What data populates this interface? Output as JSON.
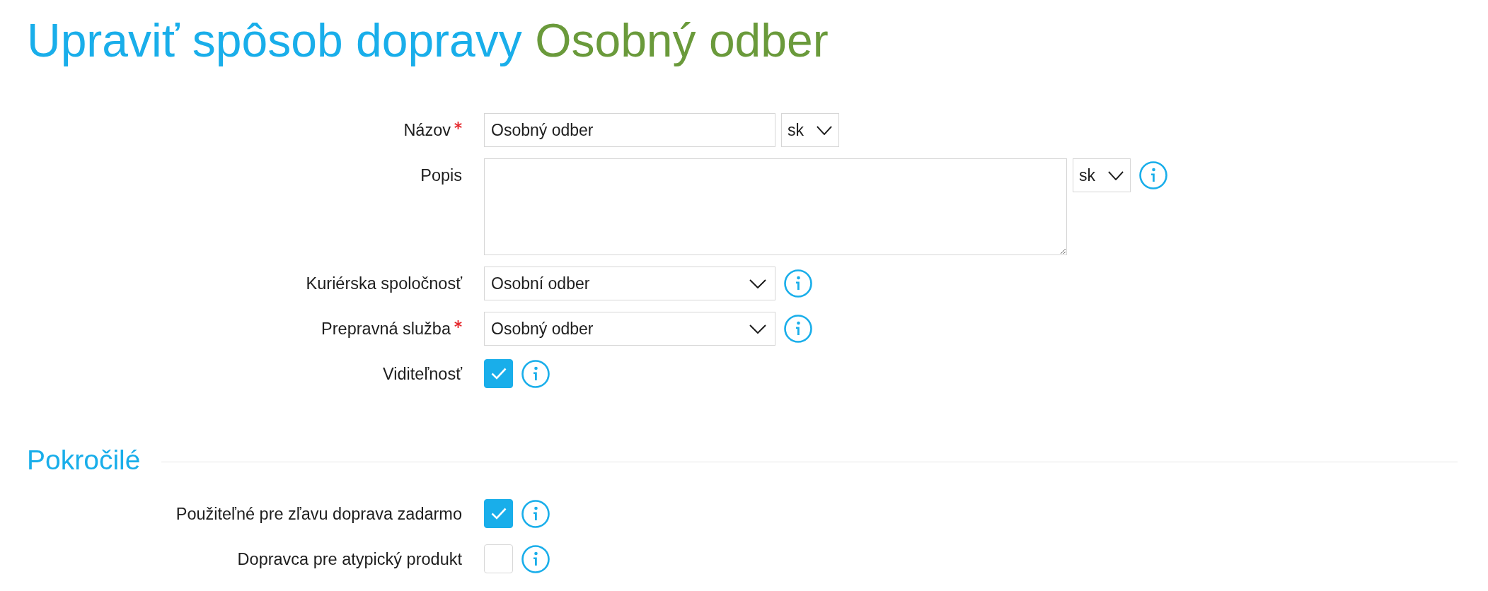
{
  "title": {
    "action": "Upraviť spôsob dopravy",
    "subject": "Osobný odber"
  },
  "form": {
    "fields": [
      {
        "kind": "text",
        "label": "Názov",
        "required": true,
        "value": "Osobný odber",
        "language": "sk",
        "info": false
      },
      {
        "kind": "textarea",
        "label": "Popis",
        "required": false,
        "language": "sk",
        "info": true
      },
      {
        "kind": "select",
        "label": "Kuriérska spoločnosť",
        "required": false,
        "value": "Osobní odber",
        "info": true
      },
      {
        "kind": "select",
        "label": "Prepravná služba",
        "required": true,
        "value": "Osobný odber",
        "info": true
      },
      {
        "kind": "checkbox",
        "label": "Viditeľnosť",
        "required": false,
        "checked": true,
        "info": true
      }
    ]
  },
  "advanced": {
    "title": "Pokročilé",
    "fields": [
      {
        "kind": "checkbox",
        "label": "Použiteľné pre zľavu doprava zadarmo",
        "required": false,
        "checked": true,
        "info": true
      },
      {
        "kind": "checkbox",
        "label": "Dopravca pre atypický produkt",
        "required": false,
        "checked": false,
        "info": true
      }
    ]
  }
}
